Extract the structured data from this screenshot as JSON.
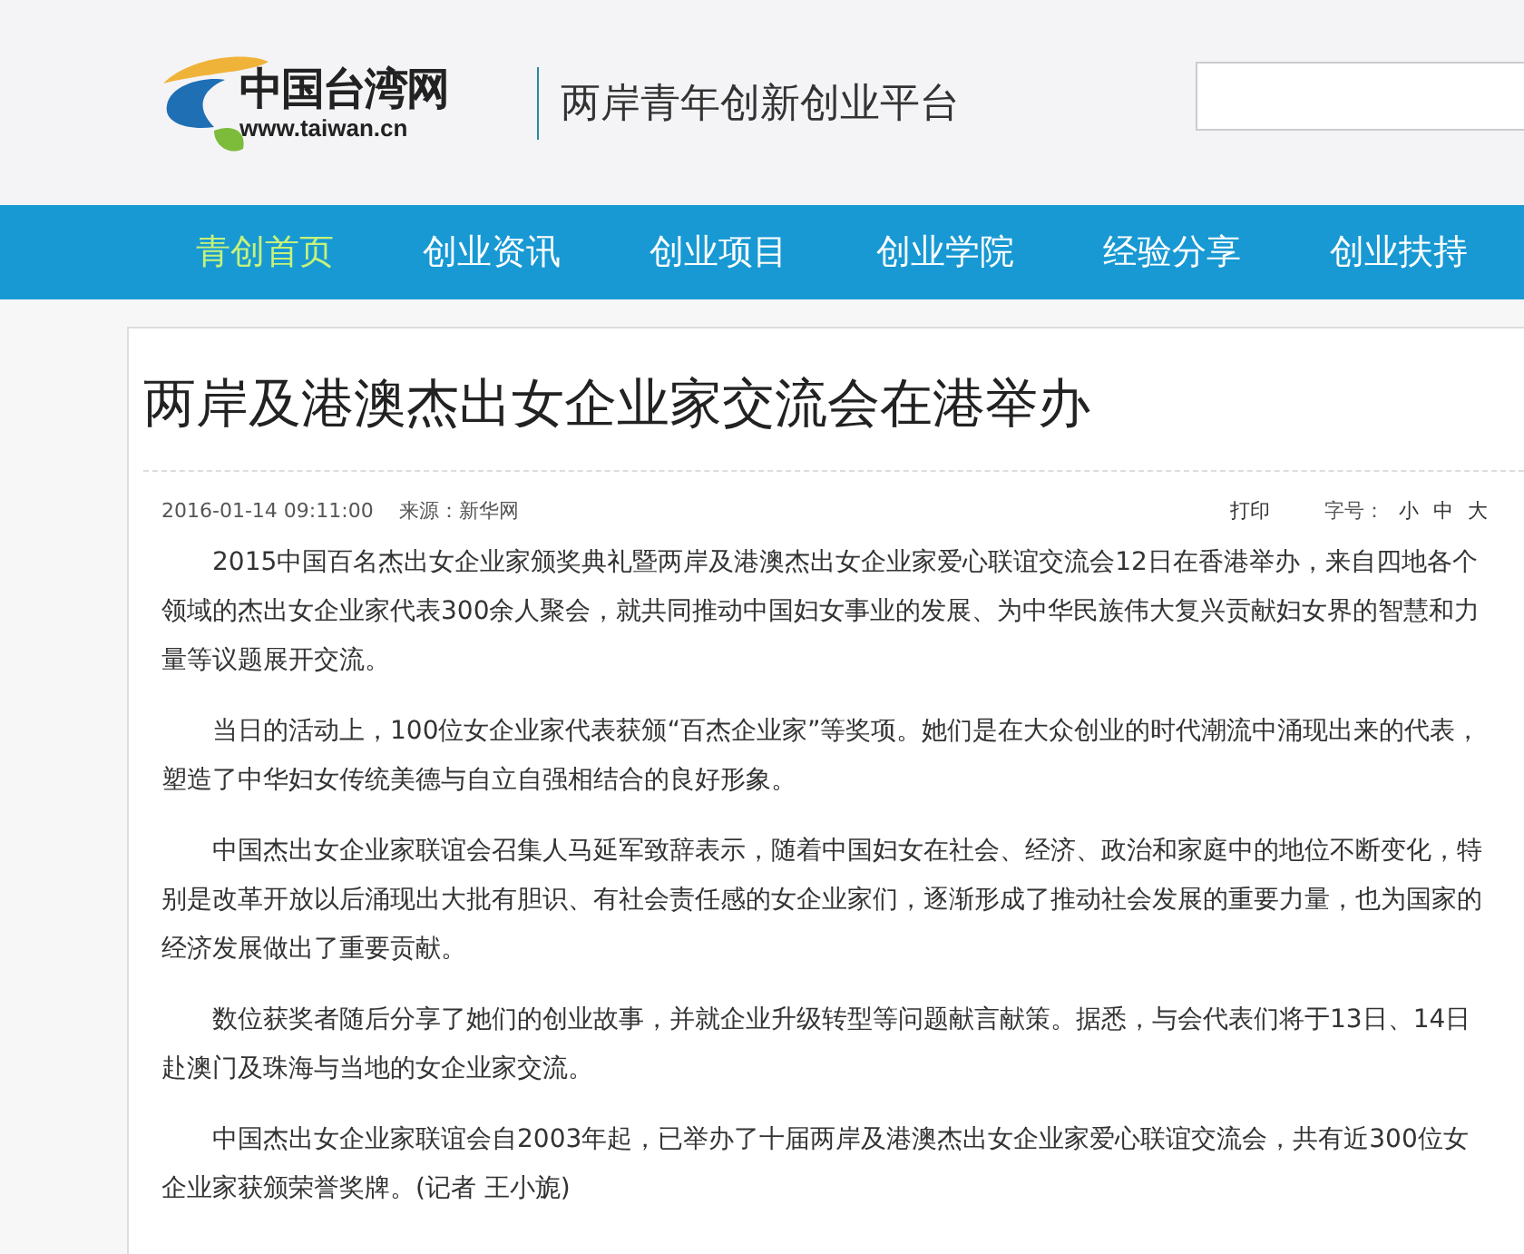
{
  "header": {
    "logo_name": "中国台湾网",
    "logo_url": "www.taiwan.cn",
    "slogan": "两岸青年创新创业平台"
  },
  "nav": [
    {
      "label": "青创首页",
      "selected": true
    },
    {
      "label": "创业资讯",
      "selected": false
    },
    {
      "label": "创业项目",
      "selected": false
    },
    {
      "label": "创业学院",
      "selected": false
    },
    {
      "label": "经验分享",
      "selected": false
    },
    {
      "label": "创业扶持",
      "selected": false
    }
  ],
  "article": {
    "title": "两岸及港澳杰出女企业家交流会在港举办",
    "date": "2016-01-14 09:11:00",
    "source": "来源：新华网",
    "print": "打印",
    "font_size_label": "字号：",
    "font_sizes": [
      "小",
      "中",
      "大"
    ],
    "paragraphs": [
      "2015中国百名杰出女企业家颁奖典礼暨两岸及港澳杰出女企业家爱心联谊交流会12日在香港举办，来自四地各个领域的杰出女企业家代表300余人聚会，就共同推动中国妇女事业的发展、为中华民族伟大复兴贡献妇女界的智慧和力量等议题展开交流。",
      "当日的活动上，100位女企业家代表获颁“百杰企业家”等奖项。她们是在大众创业的时代潮流中涌现出来的代表，塑造了中华妇女传统美德与自立自强相结合的良好形象。",
      "中国杰出女企业家联谊会召集人马延军致辞表示，随着中国妇女在社会、经济、政治和家庭中的地位不断变化，特别是改革开放以后涌现出大批有胆识、有社会责任感的女企业家们，逐渐形成了推动社会发展的重要力量，也为国家的经济发展做出了重要贡献。",
      "数位获奖者随后分享了她们的创业故事，并就企业升级转型等问题献言献策。据悉，与会代表们将于13日、14日赴澳门及珠海与当地的女企业家交流。",
      "中国杰出女企业家联谊会自2003年起，已举办了十届两岸及港澳杰出女企业家爱心联谊交流会，共有近300位女企业家获颁荣誉奖牌。(记者 王小旎)"
    ]
  }
}
